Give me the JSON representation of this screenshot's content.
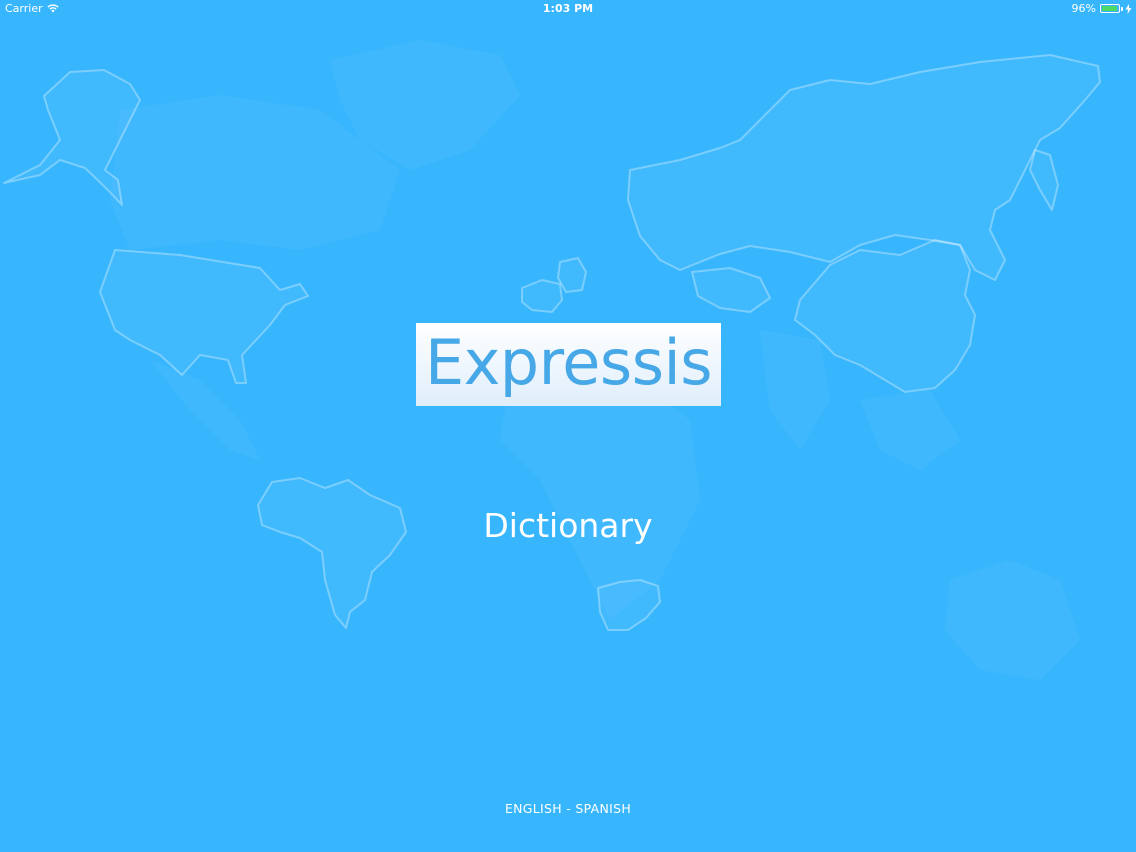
{
  "status_bar": {
    "carrier": "Carrier",
    "time": "1:03 PM",
    "battery": "96%",
    "battery_level": 0.96,
    "battery_color": "#4cd964",
    "icons": [
      "wifi-icon",
      "battery-icon",
      "charging-bolt-icon"
    ]
  },
  "splash": {
    "logo": "Expressis",
    "subtitle": "Dictionary",
    "language_pair": "ENGLISH - SPANISH"
  },
  "colors": {
    "background": "#38b6fd",
    "logo_text": "#46a8e6",
    "text": "#ffffff"
  }
}
